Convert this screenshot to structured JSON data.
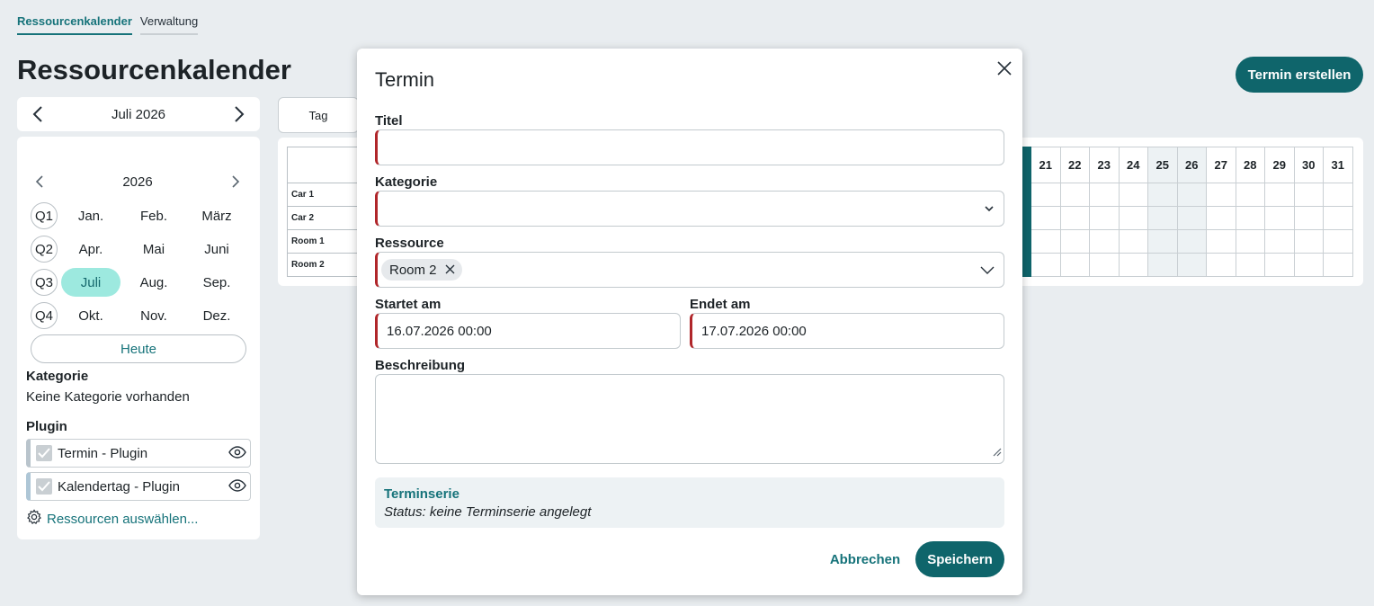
{
  "tabs": [
    {
      "label": "Ressourcenkalender"
    },
    {
      "label": "Verwaltung"
    }
  ],
  "page_title": "Ressourcenkalender",
  "create_button": "Termin erstellen",
  "month_nav": {
    "label": "Juli 2026"
  },
  "year_nav": {
    "label": "2026"
  },
  "quarters": [
    {
      "label": "Q1",
      "months": [
        "Jan.",
        "Feb.",
        "März"
      ]
    },
    {
      "label": "Q2",
      "months": [
        "Apr.",
        "Mai",
        "Juni"
      ]
    },
    {
      "label": "Q3",
      "months": [
        "Juli",
        "Aug.",
        "Sep."
      ]
    },
    {
      "label": "Q4",
      "months": [
        "Okt.",
        "Nov.",
        "Dez."
      ]
    }
  ],
  "selected_month": "Juli",
  "today_button": "Heute",
  "category": {
    "heading": "Kategorie",
    "empty_text": "Keine Kategorie vorhanden"
  },
  "plugin": {
    "heading": "Plugin",
    "items": [
      {
        "label": "Termin - Plugin"
      },
      {
        "label": "Kalendertag - Plugin"
      }
    ]
  },
  "resources_link": "Ressourcen auswählen...",
  "view_button": "Tag",
  "calendar": {
    "resources": [
      "Car 1",
      "Car 2",
      "Room 1",
      "Room 2"
    ],
    "visible_days": [
      "21",
      "22",
      "23",
      "24",
      "25",
      "26",
      "27",
      "28",
      "29",
      "30",
      "31"
    ]
  },
  "modal": {
    "title": "Termin",
    "fields": {
      "title_label": "Titel",
      "title_value": "",
      "category_label": "Kategorie",
      "category_value": "",
      "resource_label": "Ressource",
      "resource_chip": "Room 2",
      "start_label": "Startet am",
      "start_value": "16.07.2026 00:00",
      "end_label": "Endet am",
      "end_value": "17.07.2026 00:00",
      "description_label": "Beschreibung"
    },
    "series": {
      "heading": "Terminserie",
      "status": "Status: keine Terminserie angelegt"
    },
    "cancel": "Abbrechen",
    "save": "Speichern"
  },
  "colors": {
    "accent": "#0f656b",
    "link": "#16737a",
    "required": "#b0262a",
    "selected_month_bg": "#9de9df"
  }
}
